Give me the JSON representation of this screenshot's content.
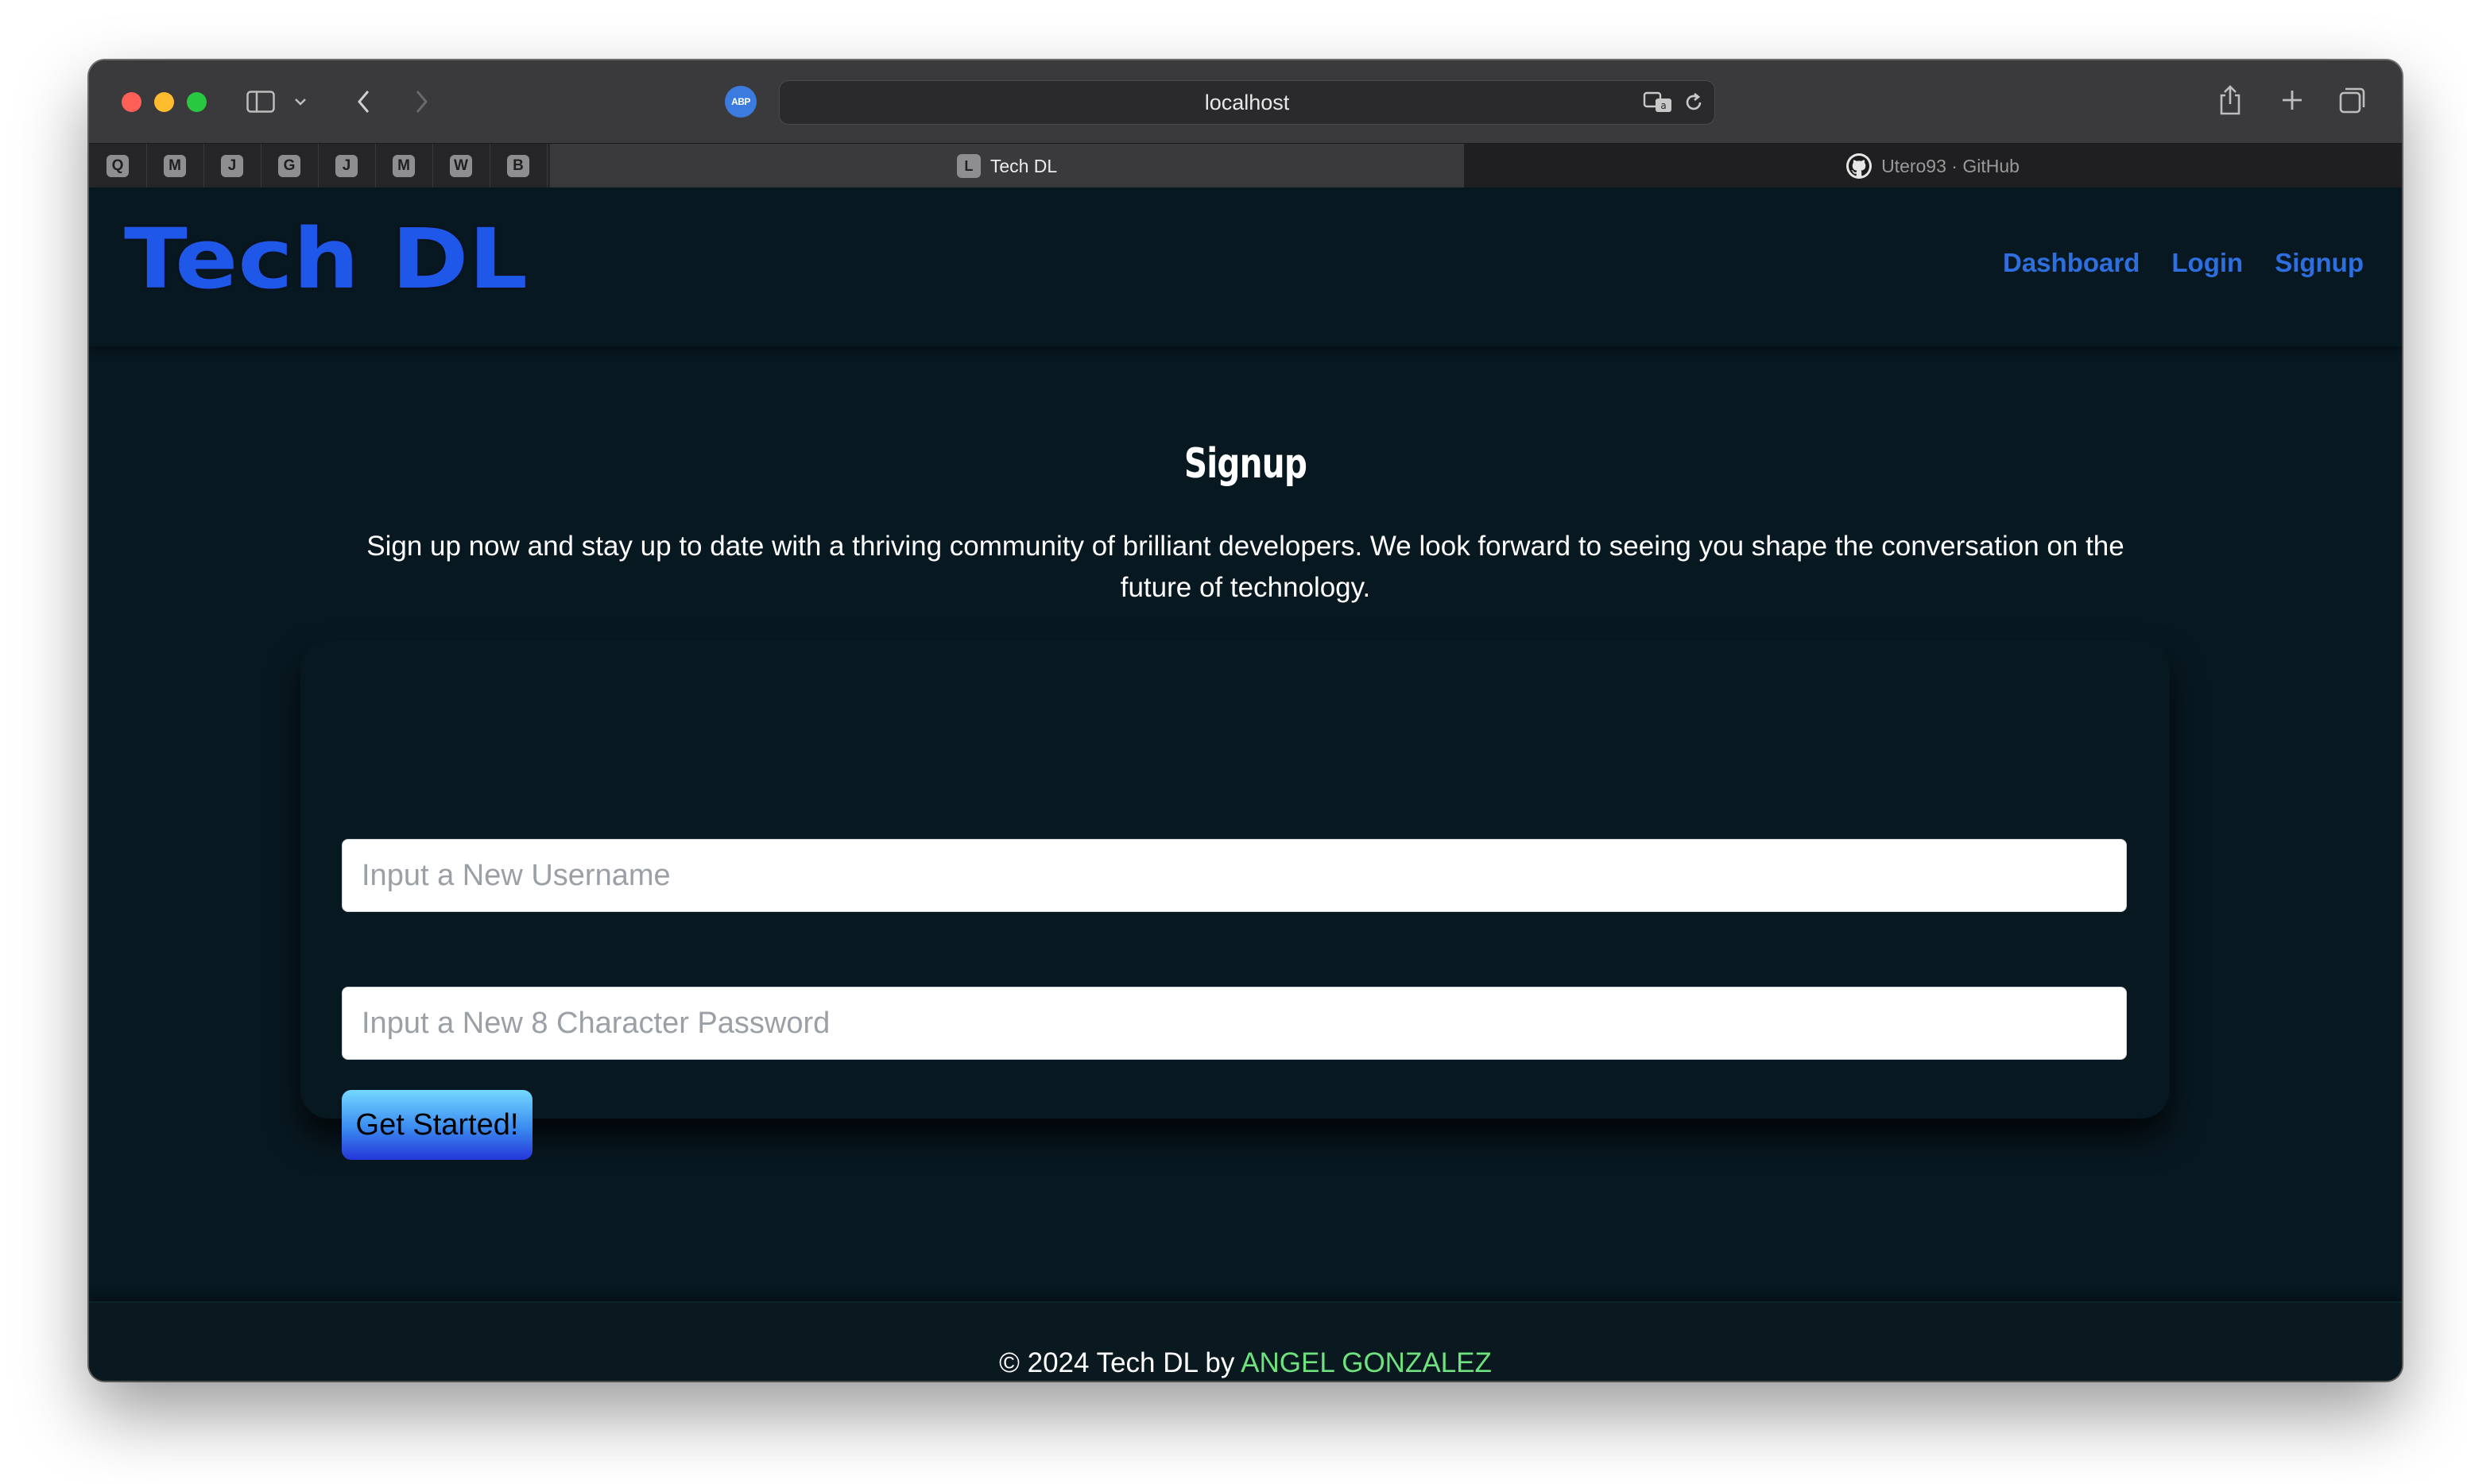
{
  "browser": {
    "url": "localhost",
    "abp_label": "ABP",
    "pinned_tabs": [
      "Q",
      "M",
      "J",
      "G",
      "J",
      "M",
      "W",
      "B"
    ],
    "tabs": [
      {
        "favicon": "L",
        "title": "Tech DL",
        "active": true
      },
      {
        "favicon": "github-icon",
        "title": "Utero93 · GitHub",
        "active": false
      }
    ]
  },
  "header": {
    "logo_text": "Tech DL",
    "nav": [
      "Dashboard",
      "Login",
      "Signup"
    ],
    "nav_color": "#2e6fe0",
    "logo_color": "#1f57e8"
  },
  "main": {
    "title": "Signup",
    "intro_line1": "Sign up now and stay up to date with a thriving community of brilliant developers. We look forward to seeing you shape the conversation on the",
    "intro_line2": "future of technology.",
    "username_placeholder": "Input a New Username",
    "password_placeholder": "Input a New 8 Character Password",
    "submit_label": "Get Started!"
  },
  "footer": {
    "copyright": "© 2024 Tech DL by ",
    "author": "ANGEL GONZALEZ",
    "author_color": "#6ee27f"
  },
  "colors": {
    "page_background": "#081821"
  }
}
